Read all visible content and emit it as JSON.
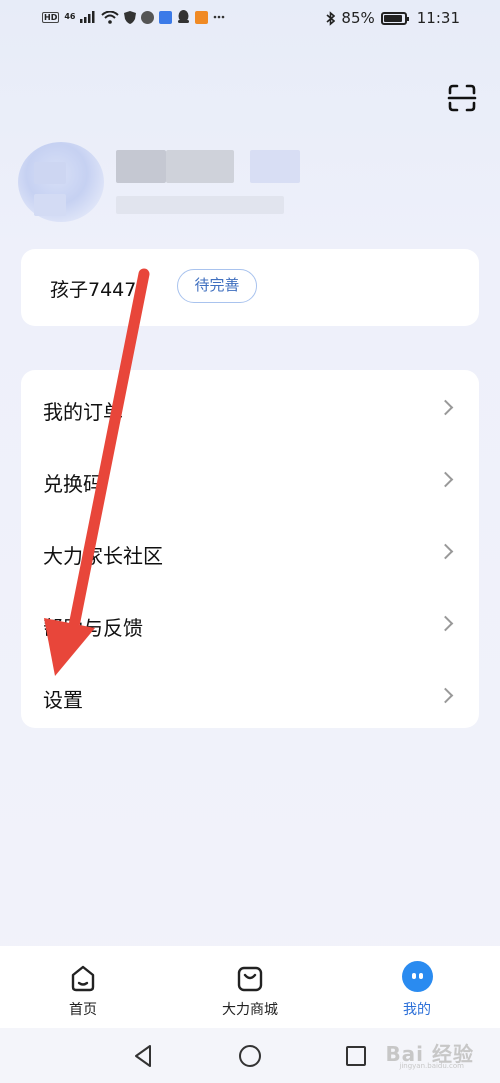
{
  "status_bar": {
    "battery_percent": "85%",
    "time": "11:31",
    "hd_label": "HD",
    "network_label": "46"
  },
  "profile": {
    "child_name": "孩子7447",
    "tag_label": "待完善"
  },
  "menu": {
    "items": [
      {
        "label": "我的订单"
      },
      {
        "label": "兑换码"
      },
      {
        "label": "大力家长社区"
      },
      {
        "label": "帮助与反馈"
      },
      {
        "label": "设置"
      }
    ]
  },
  "tabs": [
    {
      "label": "首页",
      "icon": "home-icon",
      "active": false
    },
    {
      "label": "大力商城",
      "icon": "shopping-bag-icon",
      "active": false
    },
    {
      "label": "我的",
      "icon": "me-icon",
      "active": true
    }
  ],
  "watermark": {
    "text": "Bai 经验",
    "sub": "jingyan.baidu.com"
  },
  "colors": {
    "accent": "#2b6fd8",
    "arrow": "#e8463a",
    "tag_border": "#a9c3ee"
  }
}
